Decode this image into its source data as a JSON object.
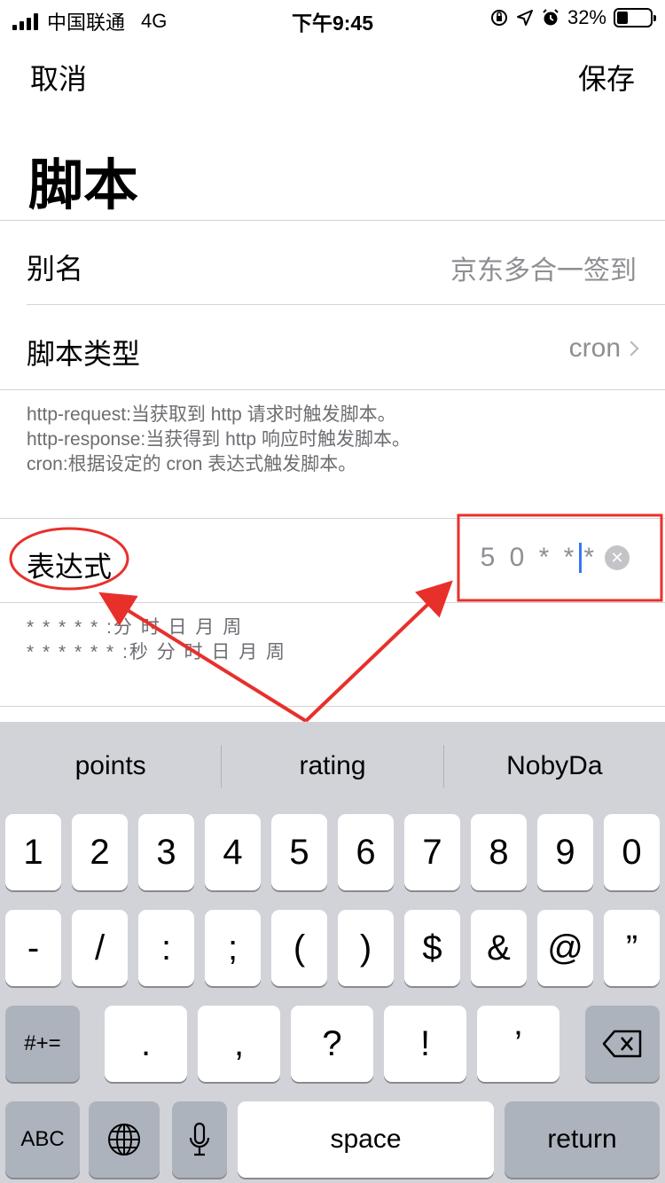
{
  "status_bar": {
    "carrier": "中国联通",
    "network": "4G",
    "time": "下午9:45",
    "battery": "32%",
    "battery_level": 0.32
  },
  "nav": {
    "cancel": "取消",
    "save": "保存"
  },
  "title": "脚本",
  "alias": {
    "label": "别名",
    "value": "京东多合一签到"
  },
  "script_type": {
    "label": "脚本类型",
    "value": "cron"
  },
  "type_help": [
    "http-request:当获取到 http 请求时触发脚本。",
    "http-response:当获得到 http 响应时触发脚本。",
    "cron:根据设定的 cron 表达式触发脚本。"
  ],
  "expression": {
    "label": "表达式",
    "value_before_caret": "5 0 * * ",
    "value_after_caret": "*"
  },
  "expression_help": [
    "* * * * * :分 时 日 月 周",
    "* * * * * * :秒 分 时 日 月 周"
  ],
  "annotation_color": "#e8302b",
  "keyboard": {
    "suggestions": [
      "points",
      "rating",
      "NobyDa"
    ],
    "row1": [
      "1",
      "2",
      "3",
      "4",
      "5",
      "6",
      "7",
      "8",
      "9",
      "0"
    ],
    "row2": [
      "-",
      "/",
      ":",
      ";",
      "(",
      ")",
      "$",
      "&",
      "@",
      "”"
    ],
    "row3_mode": "#+=",
    "row3": [
      ".",
      ",",
      "?",
      "!",
      "’"
    ],
    "abc": "ABC",
    "space": "space",
    "return": "return"
  }
}
